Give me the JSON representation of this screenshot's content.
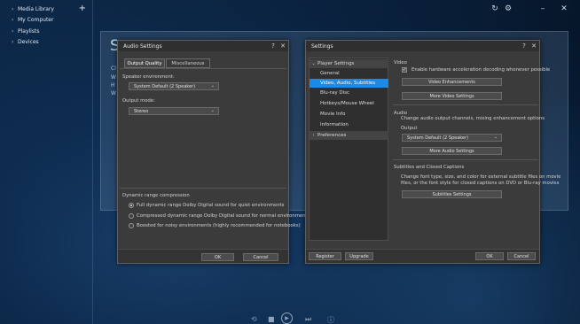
{
  "nav": {
    "items": [
      {
        "label": "Media Library"
      },
      {
        "label": "My Computer"
      },
      {
        "label": "Playlists"
      },
      {
        "label": "Devices"
      }
    ],
    "add_icon": "plus-icon"
  },
  "background": {
    "title_letter": "S",
    "snippets": [
      "Cl",
      "W",
      "H",
      "W"
    ]
  },
  "audio_dialog": {
    "title": "Audio Settings",
    "tabs": [
      "Output Quality",
      "Miscellaneous"
    ],
    "speaker_env_label": "Speaker environment:",
    "speaker_env_value": "System Default (2 Speaker)",
    "output_mode_label": "Output mode:",
    "output_mode_value": "Stereo",
    "drc_label": "Dynamic range compression",
    "drc_options": [
      {
        "label": "Full dynamic range Dolby Digital sound for quiet environments",
        "selected": true
      },
      {
        "label": "Compressed dynamic range Dolby Digital sound for normal environments",
        "selected": false
      },
      {
        "label": "Boosted for noisy environments (highly recommended for notebooks)",
        "selected": false
      }
    ],
    "ok": "OK",
    "cancel": "Cancel"
  },
  "settings_dialog": {
    "title": "Settings",
    "groups": [
      {
        "label": "Player Settings",
        "expanded": true
      },
      {
        "label": "Preferences",
        "expanded": false
      }
    ],
    "items": [
      "General",
      "Video, Audio, Subtitles",
      "Blu-ray Disc",
      "Hotkeys/Mouse Wheel",
      "Movie Info",
      "Information"
    ],
    "selected_item": "Video, Audio, Subtitles",
    "video": {
      "heading": "Video",
      "hw_accel": "Enable hardware acceleration decoding whenever possible",
      "hw_accel_checked": true,
      "enh_btn": "Video Enhancements",
      "more_btn": "More Video Settings"
    },
    "audio": {
      "heading": "Audio",
      "desc": "Change audio output channels, mixing enhancement options",
      "output_label": "Output",
      "output_value": "System Default (2 Speaker)",
      "more_btn": "More Audio Settings"
    },
    "subs": {
      "heading": "Subtitles and Closed Captions",
      "desc1": "Change font type, size, and color for external subtitle files on movie",
      "desc2": "files, or the font style for closed captions on DVD or Blu-ray movies",
      "btn": "Subtitles Settings"
    },
    "register": "Register",
    "upgrade": "Upgrade",
    "ok": "OK",
    "cancel": "Cancel"
  },
  "icons": {
    "refresh": "refresh-icon",
    "settings": "gear-icon",
    "minimize": "minimize-icon",
    "close": "close-icon",
    "help": "help-icon"
  }
}
